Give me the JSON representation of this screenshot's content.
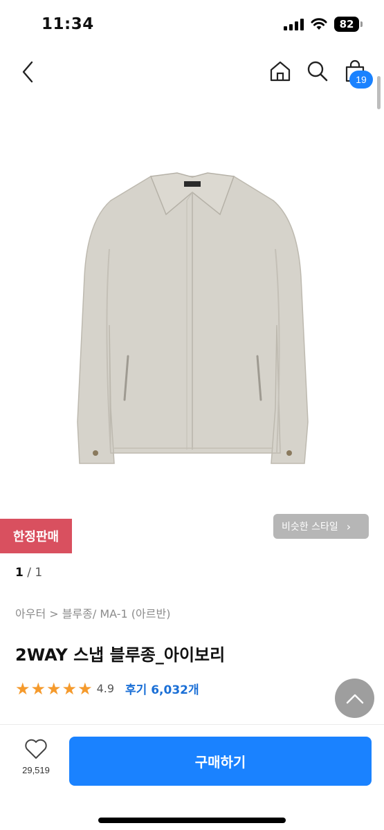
{
  "status_bar": {
    "time": "11:34",
    "battery": "82"
  },
  "header": {
    "cart_count": "19"
  },
  "product": {
    "limited_badge": "한정판매",
    "similar_style": "비슷한 스타일",
    "pager": {
      "current": "1",
      "total": " / 1"
    },
    "breadcrumb": "아우터 > 블루종/ MA-1 (아르반)",
    "title": "2WAY 스냅 블루종_아이보리",
    "rating": "4.9",
    "stars": 5,
    "review_label": "후기 6,032개",
    "image_alt": "ivory jacket product photo"
  },
  "bottom_bar": {
    "wishlist_count": "29,519",
    "buy_label": "구매하기"
  },
  "colors": {
    "accent": "#1a82ff",
    "limited": "#d9505f",
    "star": "#f59a2c"
  }
}
